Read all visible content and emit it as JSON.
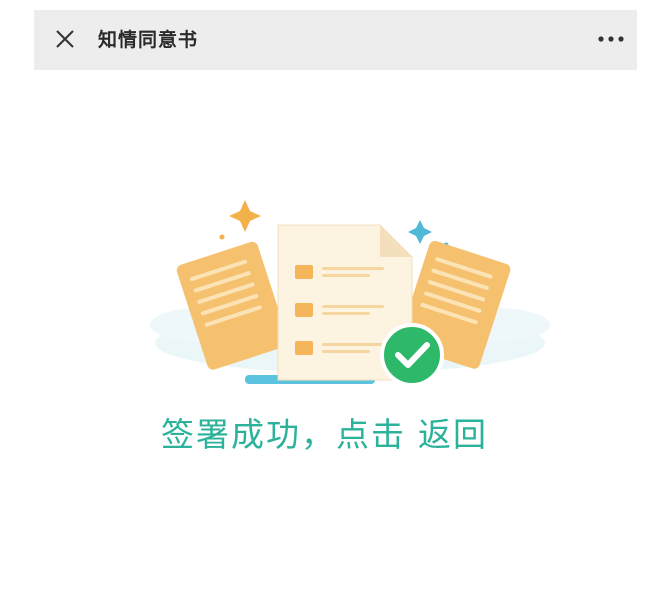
{
  "navbar": {
    "close_icon": "close-icon",
    "title": "知情同意书",
    "more_icon": "more-icon"
  },
  "illustration": {
    "icon": "signed-documents-icon",
    "check_icon": "check-circle-icon",
    "colors": {
      "paper_orange": "#f6c16f",
      "document": "#fdf3e1",
      "check_green": "#2db86a",
      "sparkle_gold": "#f3b14a",
      "sparkle_blue": "#4fb9d8"
    }
  },
  "result": {
    "message": "签署成功，点击",
    "return_link": "返回",
    "color": "#2bb29a"
  }
}
